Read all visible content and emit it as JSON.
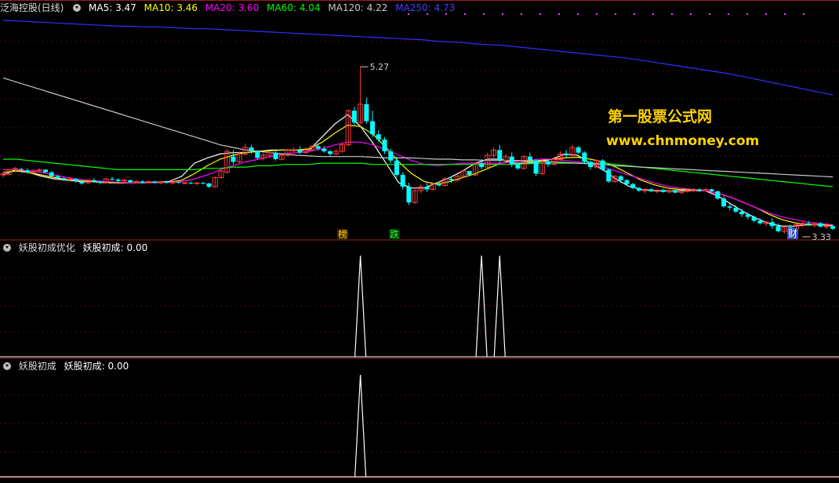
{
  "main_legend": {
    "stock_title": "泛海控股(日线)",
    "ma5": "MA5: 3.47",
    "ma10": "MA10: 3.46",
    "ma20": "MA20: 3.60",
    "ma60": "MA60: 4.04",
    "ma120": "MA120: 4.22",
    "ma250": "MA250: 4.73"
  },
  "panel2_legend": {
    "title": "妖股初成优化",
    "value": "妖股初成: 0.00"
  },
  "panel3_legend": {
    "title": "妖股初成",
    "value": "妖股初成: 0.00"
  },
  "watermark": {
    "line1": "第一股票公式网",
    "line2": "www.chnmoney.com"
  },
  "markers": {
    "bang": "榜",
    "die": "跌",
    "cai": "财"
  },
  "colors": {
    "up": "#ff3b3b",
    "down": "#00ffff",
    "ma5": "#ffffff",
    "ma10": "#ffff00",
    "ma20": "#ff00ff",
    "ma60": "#00ff00",
    "ma120": "#c8c8c8",
    "ma250": "#3030ff",
    "watermark": "#ffd400"
  },
  "chart_data": [
    {
      "type": "candlestick",
      "title": "泛海控股(日线)",
      "ylim": [
        3.0,
        5.7
      ],
      "annotations": [
        {
          "label": "5.27",
          "x_index": 59
        },
        {
          "label": "3.33",
          "x_index": 132
        }
      ],
      "candles": [
        [
          3.62,
          3.66,
          3.58,
          3.64
        ],
        [
          3.63,
          3.71,
          3.61,
          3.7
        ],
        [
          3.7,
          3.74,
          3.66,
          3.72
        ],
        [
          3.71,
          3.73,
          3.68,
          3.7
        ],
        [
          3.69,
          3.72,
          3.64,
          3.66
        ],
        [
          3.66,
          3.7,
          3.64,
          3.69
        ],
        [
          3.68,
          3.72,
          3.66,
          3.7
        ],
        [
          3.7,
          3.71,
          3.65,
          3.66
        ],
        [
          3.66,
          3.68,
          3.58,
          3.6
        ],
        [
          3.6,
          3.62,
          3.55,
          3.57
        ],
        [
          3.57,
          3.59,
          3.53,
          3.55
        ],
        [
          3.55,
          3.58,
          3.52,
          3.56
        ],
        [
          3.56,
          3.57,
          3.5,
          3.52
        ],
        [
          3.52,
          3.54,
          3.47,
          3.49
        ],
        [
          3.5,
          3.56,
          3.48,
          3.54
        ],
        [
          3.54,
          3.57,
          3.5,
          3.52
        ],
        [
          3.52,
          3.53,
          3.48,
          3.5
        ],
        [
          3.5,
          3.58,
          3.49,
          3.56
        ],
        [
          3.56,
          3.59,
          3.53,
          3.55
        ],
        [
          3.55,
          3.57,
          3.51,
          3.53
        ],
        [
          3.53,
          3.56,
          3.51,
          3.54
        ],
        [
          3.54,
          3.55,
          3.5,
          3.51
        ],
        [
          3.51,
          3.54,
          3.49,
          3.52
        ],
        [
          3.52,
          3.54,
          3.49,
          3.5
        ],
        [
          3.5,
          3.53,
          3.49,
          3.52
        ],
        [
          3.52,
          3.53,
          3.49,
          3.5
        ],
        [
          3.5,
          3.52,
          3.48,
          3.51
        ],
        [
          3.51,
          3.53,
          3.49,
          3.5
        ],
        [
          3.5,
          3.52,
          3.48,
          3.51
        ],
        [
          3.51,
          3.52,
          3.49,
          3.5
        ],
        [
          3.5,
          3.51,
          3.48,
          3.5
        ],
        [
          3.5,
          3.52,
          3.48,
          3.49
        ],
        [
          3.49,
          3.51,
          3.47,
          3.5
        ],
        [
          3.5,
          3.51,
          3.48,
          3.49
        ],
        [
          3.49,
          3.5,
          3.42,
          3.44
        ],
        [
          3.44,
          3.6,
          3.43,
          3.58
        ],
        [
          3.58,
          3.7,
          3.56,
          3.68
        ],
        [
          3.66,
          4.02,
          3.64,
          3.98
        ],
        [
          3.9,
          4.0,
          3.78,
          3.82
        ],
        [
          3.82,
          3.98,
          3.8,
          3.94
        ],
        [
          3.94,
          4.1,
          3.92,
          4.04
        ],
        [
          4.04,
          4.08,
          3.94,
          3.98
        ],
        [
          3.98,
          4.0,
          3.86,
          3.88
        ],
        [
          3.88,
          3.96,
          3.84,
          3.92
        ],
        [
          3.92,
          3.98,
          3.88,
          3.96
        ],
        [
          3.96,
          3.98,
          3.84,
          3.86
        ],
        [
          3.86,
          3.94,
          3.84,
          3.92
        ],
        [
          3.92,
          4.02,
          3.9,
          4.0
        ],
        [
          4.0,
          4.04,
          3.96,
          4.0
        ],
        [
          4.0,
          4.06,
          3.94,
          3.96
        ],
        [
          3.96,
          4.04,
          3.94,
          4.0
        ],
        [
          4.0,
          4.08,
          3.98,
          4.06
        ],
        [
          4.06,
          4.1,
          4.0,
          4.02
        ],
        [
          4.02,
          4.06,
          3.96,
          3.98
        ],
        [
          3.98,
          4.0,
          3.9,
          3.94
        ],
        [
          3.94,
          4.02,
          3.92,
          3.98
        ],
        [
          3.98,
          4.12,
          3.96,
          4.08
        ],
        [
          4.08,
          4.62,
          4.06,
          4.6
        ],
        [
          4.6,
          4.66,
          4.38,
          4.42
        ],
        [
          4.42,
          5.27,
          4.4,
          4.7
        ],
        [
          4.7,
          4.8,
          4.4,
          4.44
        ],
        [
          4.44,
          4.6,
          4.2,
          4.24
        ],
        [
          4.24,
          4.3,
          4.12,
          4.16
        ],
        [
          4.16,
          4.2,
          3.94,
          3.98
        ],
        [
          3.98,
          4.02,
          3.8,
          3.84
        ],
        [
          3.84,
          3.9,
          3.58,
          3.62
        ],
        [
          3.62,
          3.66,
          3.4,
          3.44
        ],
        [
          3.44,
          3.5,
          3.16,
          3.2
        ],
        [
          3.2,
          3.4,
          3.18,
          3.38
        ],
        [
          3.38,
          3.48,
          3.34,
          3.44
        ],
        [
          3.44,
          3.5,
          3.36,
          3.4
        ],
        [
          3.4,
          3.5,
          3.38,
          3.48
        ],
        [
          3.48,
          3.52,
          3.44,
          3.46
        ],
        [
          3.46,
          3.58,
          3.44,
          3.56
        ],
        [
          3.56,
          3.6,
          3.5,
          3.54
        ],
        [
          3.54,
          3.62,
          3.52,
          3.6
        ],
        [
          3.6,
          3.7,
          3.58,
          3.68
        ],
        [
          3.68,
          3.64,
          3.6,
          3.62
        ],
        [
          3.62,
          3.82,
          3.6,
          3.8
        ],
        [
          3.8,
          3.86,
          3.7,
          3.74
        ],
        [
          3.74,
          3.96,
          3.72,
          3.92
        ],
        [
          3.92,
          4.04,
          3.88,
          4.0
        ],
        [
          4.0,
          4.08,
          3.8,
          3.84
        ],
        [
          3.84,
          3.94,
          3.82,
          3.9
        ],
        [
          3.9,
          3.96,
          3.74,
          3.78
        ],
        [
          3.78,
          3.8,
          3.7,
          3.72
        ],
        [
          3.72,
          3.92,
          3.7,
          3.9
        ],
        [
          3.9,
          3.96,
          3.8,
          3.84
        ],
        [
          3.84,
          3.86,
          3.6,
          3.64
        ],
        [
          3.64,
          3.84,
          3.62,
          3.82
        ],
        [
          3.82,
          3.86,
          3.74,
          3.78
        ],
        [
          3.78,
          3.9,
          3.76,
          3.86
        ],
        [
          3.86,
          3.98,
          3.84,
          3.94
        ],
        [
          3.94,
          4.0,
          3.88,
          3.92
        ],
        [
          3.92,
          4.08,
          3.9,
          4.04
        ],
        [
          4.04,
          4.06,
          3.94,
          3.96
        ],
        [
          3.96,
          3.98,
          3.8,
          3.82
        ],
        [
          3.82,
          3.84,
          3.7,
          3.74
        ],
        [
          3.74,
          3.86,
          3.72,
          3.84
        ],
        [
          3.84,
          3.86,
          3.68,
          3.7
        ],
        [
          3.7,
          3.72,
          3.5,
          3.52
        ],
        [
          3.52,
          3.62,
          3.5,
          3.6
        ],
        [
          3.6,
          3.62,
          3.5,
          3.54
        ],
        [
          3.54,
          3.56,
          3.46,
          3.48
        ],
        [
          3.48,
          3.5,
          3.4,
          3.42
        ],
        [
          3.42,
          3.44,
          3.36,
          3.38
        ],
        [
          3.38,
          3.42,
          3.34,
          3.4
        ],
        [
          3.4,
          3.42,
          3.36,
          3.37
        ],
        [
          3.37,
          3.4,
          3.34,
          3.39
        ],
        [
          3.39,
          3.41,
          3.35,
          3.36
        ],
        [
          3.36,
          3.4,
          3.34,
          3.38
        ],
        [
          3.38,
          3.4,
          3.34,
          3.35
        ],
        [
          3.35,
          3.38,
          3.33,
          3.37
        ],
        [
          3.37,
          3.4,
          3.35,
          3.38
        ],
        [
          3.38,
          3.42,
          3.36,
          3.4
        ],
        [
          3.4,
          3.42,
          3.36,
          3.38
        ],
        [
          3.38,
          3.42,
          3.37,
          3.4
        ],
        [
          3.4,
          3.41,
          3.36,
          3.37
        ],
        [
          3.37,
          3.38,
          3.24,
          3.26
        ],
        [
          3.26,
          3.3,
          3.12,
          3.14
        ],
        [
          3.14,
          3.18,
          3.08,
          3.12
        ],
        [
          3.12,
          3.16,
          3.04,
          3.06
        ],
        [
          3.06,
          3.1,
          2.98,
          3.02
        ],
        [
          3.02,
          3.04,
          2.94,
          2.98
        ],
        [
          2.98,
          3.0,
          2.9,
          2.92
        ],
        [
          2.92,
          2.96,
          2.86,
          2.88
        ],
        [
          2.88,
          2.92,
          2.84,
          2.9
        ],
        [
          2.9,
          2.96,
          2.8,
          2.84
        ],
        [
          2.84,
          2.88,
          2.74,
          2.76
        ],
        [
          2.76,
          2.84,
          2.72,
          2.82
        ],
        [
          2.82,
          2.86,
          2.78,
          2.8
        ],
        [
          2.8,
          2.88,
          2.78,
          2.86
        ],
        [
          2.86,
          2.9,
          2.82,
          2.88
        ],
        [
          2.88,
          2.92,
          2.84,
          2.86
        ],
        [
          2.86,
          2.9,
          2.82,
          2.88
        ],
        [
          2.88,
          2.9,
          2.82,
          2.83
        ],
        [
          2.83,
          2.86,
          2.8,
          2.84
        ],
        [
          2.84,
          2.86,
          2.78,
          2.8
        ]
      ],
      "ma": {
        "MA5": [
          3.62,
          3.7,
          3.66,
          3.6,
          3.56,
          3.54,
          3.52,
          3.52,
          3.5,
          3.5,
          3.5,
          3.5,
          3.51,
          3.52,
          3.6,
          3.8,
          3.88,
          3.94,
          3.96,
          3.96,
          3.98,
          4.0,
          4.0,
          4.0,
          4.0,
          4.2,
          4.4,
          4.54,
          4.36,
          4.1,
          3.8,
          3.5,
          3.42,
          3.42,
          3.5,
          3.58,
          3.68,
          3.8,
          3.86,
          3.86,
          3.8,
          3.8,
          3.82,
          3.86,
          3.94,
          3.92,
          3.8,
          3.7,
          3.56,
          3.45,
          3.4,
          3.38,
          3.38,
          3.38,
          3.38,
          3.38,
          3.3,
          3.18,
          3.06,
          2.96,
          2.88,
          2.84,
          2.84,
          2.86,
          2.86,
          2.85
        ],
        "MA10": [
          3.66,
          3.68,
          3.66,
          3.62,
          3.58,
          3.55,
          3.53,
          3.52,
          3.51,
          3.5,
          3.5,
          3.5,
          3.51,
          3.51,
          3.54,
          3.64,
          3.76,
          3.86,
          3.92,
          3.96,
          3.98,
          3.99,
          4.0,
          4.0,
          4.02,
          4.12,
          4.26,
          4.38,
          4.36,
          4.24,
          4.04,
          3.82,
          3.64,
          3.52,
          3.48,
          3.52,
          3.58,
          3.64,
          3.72,
          3.8,
          3.84,
          3.82,
          3.84,
          3.86,
          3.88,
          3.89,
          3.86,
          3.82,
          3.74,
          3.64,
          3.54,
          3.47,
          3.42,
          3.4,
          3.39,
          3.38,
          3.34,
          3.28,
          3.2,
          3.12,
          3.02,
          2.94,
          2.89,
          2.86,
          2.86,
          2.85
        ],
        "MA20": [
          3.7,
          3.7,
          3.68,
          3.66,
          3.62,
          3.58,
          3.55,
          3.53,
          3.52,
          3.51,
          3.5,
          3.5,
          3.5,
          3.51,
          3.52,
          3.56,
          3.62,
          3.7,
          3.76,
          3.82,
          3.86,
          3.9,
          3.94,
          3.96,
          3.98,
          4.02,
          4.08,
          4.12,
          4.12,
          4.08,
          4.0,
          3.92,
          3.84,
          3.78,
          3.76,
          3.78,
          3.8,
          3.8,
          3.8,
          3.8,
          3.82,
          3.84,
          3.86,
          3.86,
          3.84,
          3.82,
          3.78,
          3.74,
          3.68,
          3.62,
          3.56,
          3.5,
          3.45,
          3.42,
          3.4,
          3.38,
          3.34,
          3.28,
          3.2,
          3.12,
          3.04,
          2.98,
          2.94,
          2.9,
          2.88,
          2.86
        ],
        "MA60": [
          3.86,
          3.86,
          3.84,
          3.82,
          3.8,
          3.78,
          3.76,
          3.74,
          3.72,
          3.7,
          3.7,
          3.7,
          3.7,
          3.7,
          3.7,
          3.7,
          3.72,
          3.72,
          3.74,
          3.74,
          3.76,
          3.76,
          3.78,
          3.78,
          3.78,
          3.8,
          3.8,
          3.8,
          3.8,
          3.78,
          3.78,
          3.78,
          3.78,
          3.78,
          3.78,
          3.78,
          3.78,
          3.78,
          3.78,
          3.78,
          3.78,
          3.79,
          3.8,
          3.8,
          3.8,
          3.8,
          3.8,
          3.8,
          3.78,
          3.76,
          3.74,
          3.72,
          3.7,
          3.68,
          3.66,
          3.64,
          3.62,
          3.6,
          3.58,
          3.56,
          3.54,
          3.52,
          3.5,
          3.48,
          3.46,
          3.44
        ],
        "MA120": [
          5.1,
          5.04,
          4.98,
          4.92,
          4.86,
          4.8,
          4.74,
          4.68,
          4.62,
          4.56,
          4.5,
          4.44,
          4.38,
          4.32,
          4.26,
          4.2,
          4.14,
          4.08,
          4.04,
          4.0,
          3.98,
          3.96,
          3.94,
          3.92,
          3.91,
          3.9,
          3.9,
          3.9,
          3.9,
          3.89,
          3.88,
          3.88,
          3.88,
          3.87,
          3.86,
          3.86,
          3.85,
          3.85,
          3.84,
          3.84,
          3.84,
          3.84,
          3.83,
          3.82,
          3.81,
          3.8,
          3.79,
          3.78,
          3.76,
          3.75,
          3.74,
          3.73,
          3.72,
          3.71,
          3.7,
          3.69,
          3.68,
          3.67,
          3.66,
          3.65,
          3.64,
          3.63,
          3.62,
          3.61,
          3.6,
          3.59
        ],
        "MA250": [
          5.98,
          5.97,
          5.96,
          5.95,
          5.94,
          5.93,
          5.92,
          5.91,
          5.9,
          5.89,
          5.89,
          5.88,
          5.88,
          5.87,
          5.86,
          5.85,
          5.85,
          5.84,
          5.83,
          5.82,
          5.81,
          5.8,
          5.79,
          5.78,
          5.77,
          5.76,
          5.75,
          5.74,
          5.73,
          5.72,
          5.71,
          5.7,
          5.69,
          5.68,
          5.66,
          5.65,
          5.64,
          5.62,
          5.61,
          5.6,
          5.58,
          5.56,
          5.54,
          5.52,
          5.5,
          5.48,
          5.46,
          5.44,
          5.42,
          5.4,
          5.37,
          5.34,
          5.31,
          5.28,
          5.25,
          5.22,
          5.19,
          5.16,
          5.12,
          5.08,
          5.04,
          5.0,
          4.96,
          4.92,
          4.88,
          4.84
        ]
      }
    },
    {
      "type": "line",
      "title": "妖股初成优化",
      "series": [
        {
          "name": "妖股初成",
          "spikes_at_index": [
            59,
            79,
            82
          ],
          "baseline": 0,
          "peak": 1
        }
      ]
    },
    {
      "type": "line",
      "title": "妖股初成",
      "series": [
        {
          "name": "妖股初成",
          "spikes_at_index": [
            59
          ],
          "baseline": 0,
          "peak": 1
        }
      ]
    }
  ]
}
